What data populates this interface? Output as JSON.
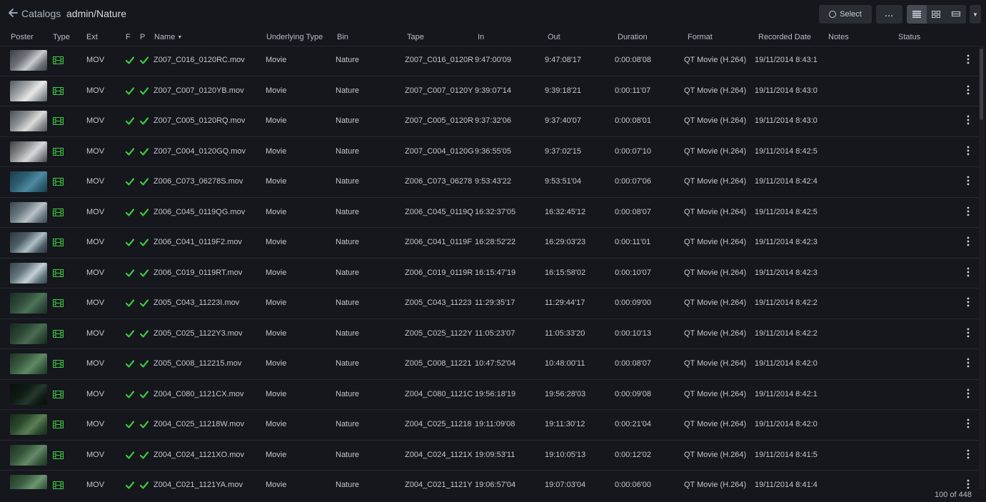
{
  "app": {
    "breadcrumb_root": "Catalogs",
    "breadcrumb_path": "admin/Nature"
  },
  "toolbar": {
    "select_label": "Select",
    "more_label": "...",
    "views": [
      "list-view-icon",
      "grid-view-icon",
      "filmstrip-view-icon"
    ],
    "active_view": "list"
  },
  "columns": [
    "Poster",
    "Type",
    "Ext",
    "F",
    "P",
    "Name",
    "Underlying Type",
    "Bin",
    "Tape",
    "In",
    "Out",
    "Duration",
    "Format",
    "Recorded Date",
    "Notes",
    "Status"
  ],
  "sort": {
    "column": "Name",
    "direction": "desc"
  },
  "colors": {
    "check": "#3fc73f",
    "type_icon": "#3fc73f",
    "background": "#15171d"
  },
  "rows": [
    {
      "ext": "MOV",
      "name": "Z007_C016_0120RC.mov",
      "underlying": "Movie",
      "bin": "Nature",
      "tape": "Z007_C016_0120R",
      "in": "9:47:00'09",
      "out": "9:47:08'17",
      "duration": "0:00:08'08",
      "format": "QT Movie (H.264)",
      "recorded": "19/11/2014 8:43:1"
    },
    {
      "ext": "MOV",
      "name": "Z007_C007_0120YB.mov",
      "underlying": "Movie",
      "bin": "Nature",
      "tape": "Z007_C007_0120Y",
      "in": "9:39:07'14",
      "out": "9:39:18'21",
      "duration": "0:00:11'07",
      "format": "QT Movie (H.264)",
      "recorded": "19/11/2014 8:43:0"
    },
    {
      "ext": "MOV",
      "name": "Z007_C005_0120RQ.mov",
      "underlying": "Movie",
      "bin": "Nature",
      "tape": "Z007_C005_0120R",
      "in": "9:37:32'06",
      "out": "9:37:40'07",
      "duration": "0:00:08'01",
      "format": "QT Movie (H.264)",
      "recorded": "19/11/2014 8:43:0"
    },
    {
      "ext": "MOV",
      "name": "Z007_C004_0120GQ.mov",
      "underlying": "Movie",
      "bin": "Nature",
      "tape": "Z007_C004_0120G",
      "in": "9:36:55'05",
      "out": "9:37:02'15",
      "duration": "0:00:07'10",
      "format": "QT Movie (H.264)",
      "recorded": "19/11/2014 8:42:5"
    },
    {
      "ext": "MOV",
      "name": "Z006_C073_06278S.mov",
      "underlying": "Movie",
      "bin": "Nature",
      "tape": "Z006_C073_06278",
      "in": "9:53:43'22",
      "out": "9:53:51'04",
      "duration": "0:00:07'06",
      "format": "QT Movie (H.264)",
      "recorded": "19/11/2014 8:42:4"
    },
    {
      "ext": "MOV",
      "name": "Z006_C045_0119QG.mov",
      "underlying": "Movie",
      "bin": "Nature",
      "tape": "Z006_C045_0119Q",
      "in": "16:32:37'05",
      "out": "16:32:45'12",
      "duration": "0:00:08'07",
      "format": "QT Movie (H.264)",
      "recorded": "19/11/2014 8:42:5"
    },
    {
      "ext": "MOV",
      "name": "Z006_C041_0119F2.mov",
      "underlying": "Movie",
      "bin": "Nature",
      "tape": "Z006_C041_0119F",
      "in": "16:28:52'22",
      "out": "16:29:03'23",
      "duration": "0:00:11'01",
      "format": "QT Movie (H.264)",
      "recorded": "19/11/2014 8:42:3"
    },
    {
      "ext": "MOV",
      "name": "Z006_C019_0119RT.mov",
      "underlying": "Movie",
      "bin": "Nature",
      "tape": "Z006_C019_0119R",
      "in": "16:15:47'19",
      "out": "16:15:58'02",
      "duration": "0:00:10'07",
      "format": "QT Movie (H.264)",
      "recorded": "19/11/2014 8:42:3"
    },
    {
      "ext": "MOV",
      "name": "Z005_C043_11223I.mov",
      "underlying": "Movie",
      "bin": "Nature",
      "tape": "Z005_C043_11223",
      "in": "11:29:35'17",
      "out": "11:29:44'17",
      "duration": "0:00:09'00",
      "format": "QT Movie (H.264)",
      "recorded": "19/11/2014 8:42:2"
    },
    {
      "ext": "MOV",
      "name": "Z005_C025_1122Y3.mov",
      "underlying": "Movie",
      "bin": "Nature",
      "tape": "Z005_C025_1122Y",
      "in": "11:05:23'07",
      "out": "11:05:33'20",
      "duration": "0:00:10'13",
      "format": "QT Movie (H.264)",
      "recorded": "19/11/2014 8:42:2"
    },
    {
      "ext": "MOV",
      "name": "Z005_C008_112215.mov",
      "underlying": "Movie",
      "bin": "Nature",
      "tape": "Z005_C008_11221",
      "in": "10:47:52'04",
      "out": "10:48:00'11",
      "duration": "0:00:08'07",
      "format": "QT Movie (H.264)",
      "recorded": "19/11/2014 8:42:0"
    },
    {
      "ext": "MOV",
      "name": "Z004_C080_1121CX.mov",
      "underlying": "Movie",
      "bin": "Nature",
      "tape": "Z004_C080_1121C",
      "in": "19:56:18'19",
      "out": "19:56:28'03",
      "duration": "0:00:09'08",
      "format": "QT Movie (H.264)",
      "recorded": "19/11/2014 8:42:1"
    },
    {
      "ext": "MOV",
      "name": "Z004_C025_11218W.mov",
      "underlying": "Movie",
      "bin": "Nature",
      "tape": "Z004_C025_11218",
      "in": "19:11:09'08",
      "out": "19:11:30'12",
      "duration": "0:00:21'04",
      "format": "QT Movie (H.264)",
      "recorded": "19/11/2014 8:42:0"
    },
    {
      "ext": "MOV",
      "name": "Z004_C024_1121XO.mov",
      "underlying": "Movie",
      "bin": "Nature",
      "tape": "Z004_C024_1121X",
      "in": "19:09:53'11",
      "out": "19:10:05'13",
      "duration": "0:00:12'02",
      "format": "QT Movie (H.264)",
      "recorded": "19/11/2014 8:41:5"
    },
    {
      "ext": "MOV",
      "name": "Z004_C021_1121YA.mov",
      "underlying": "Movie",
      "bin": "Nature",
      "tape": "Z004_C021_1121Y",
      "in": "19:06:57'04",
      "out": "19:07:03'04",
      "duration": "0:00:06'00",
      "format": "QT Movie (H.264)",
      "recorded": "19/11/2014 8:41:4"
    }
  ],
  "footer": {
    "count_label": "100 of 448"
  }
}
